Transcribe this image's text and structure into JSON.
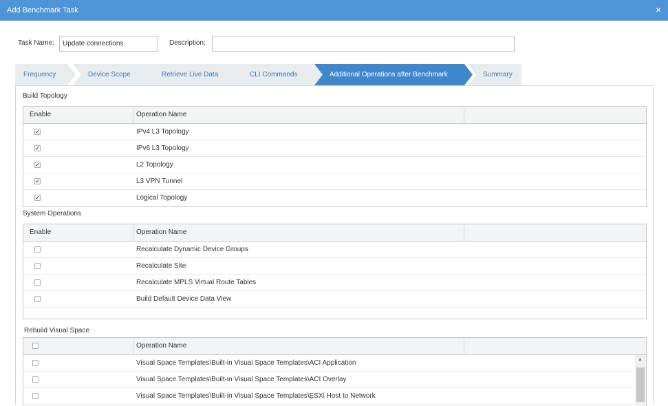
{
  "window": {
    "title": "Add Benchmark Task",
    "close_icon": "×"
  },
  "form": {
    "task_name_label": "Task Name:",
    "task_name_value": "Update connections",
    "description_label": "Description:",
    "description_value": ""
  },
  "tabs": [
    {
      "label": "Frequency"
    },
    {
      "label": "Device Scope"
    },
    {
      "label": "Retrieve Live Data"
    },
    {
      "label": "CLI Commands"
    },
    {
      "label": "Additional Operations after Benchmark",
      "active": true
    },
    {
      "label": "Summary"
    }
  ],
  "sections": {
    "build_topology": {
      "title": "Build Topology",
      "col_enable": "Enable",
      "col_name": "Operation Name",
      "rows": [
        {
          "name": "IPv4 L3 Topology",
          "checked": true
        },
        {
          "name": "IPv6 L3 Topology",
          "checked": true
        },
        {
          "name": "L2 Topology",
          "checked": true
        },
        {
          "name": "L3 VPN Tunnel",
          "checked": true
        },
        {
          "name": "Logical Topology",
          "checked": true
        }
      ]
    },
    "system_operations": {
      "title": "System Operations",
      "col_enable": "Enable",
      "col_name": "Operation Name",
      "rows": [
        {
          "name": "Recalculate Dynamic Device Groups",
          "checked": false
        },
        {
          "name": "Recalculate Site",
          "checked": false
        },
        {
          "name": "Recalculate MPLS Virtual Route Tables",
          "checked": false
        },
        {
          "name": "Build Default Device Data View",
          "checked": false
        }
      ]
    },
    "rebuild_visual_space": {
      "title": "Rebuild Visual Space",
      "col_name": "Operation Name",
      "rows": [
        {
          "name": "Visual Space Templates\\Built-in Visual Space Templates\\ACI Application",
          "checked": false
        },
        {
          "name": "Visual Space Templates\\Built-in Visual Space Templates\\ACI Overlay",
          "checked": false
        },
        {
          "name": "Visual Space Templates\\Built-in Visual Space Templates\\ESXi Host to Network",
          "checked": false
        }
      ]
    }
  },
  "colors": {
    "titlebar": "#4d95d6",
    "active_tab": "#3f87cc",
    "tab_text": "#3a78b8"
  }
}
